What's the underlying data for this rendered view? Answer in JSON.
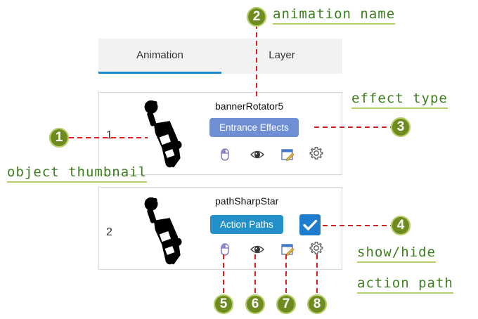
{
  "tabs": [
    {
      "label": "Animation",
      "active": true
    },
    {
      "label": "Layer",
      "active": false
    }
  ],
  "rows": [
    {
      "number": "1",
      "name": "bannerRotator5",
      "effect": "Entrance Effects"
    },
    {
      "number": "2",
      "name": "pathSharpStar",
      "effect": "Action Paths",
      "show_action_path": true
    }
  ],
  "callouts": {
    "c1": {
      "badge": "1",
      "text": "object thumbnail"
    },
    "c2": {
      "badge": "2",
      "text": "animation name"
    },
    "c3": {
      "badge": "3",
      "text": "effect type"
    },
    "c4": {
      "badge": "4",
      "text_line1": "show/hide",
      "text_line2": "action path"
    },
    "c5": {
      "badge": "5"
    },
    "c6": {
      "badge": "6"
    },
    "c7": {
      "badge": "7"
    },
    "c8": {
      "badge": "8"
    }
  },
  "colors": {
    "tab_accent": "#1c8ad3",
    "entrance_button": "#6e8fd4",
    "action_button": "#2391c7",
    "checkbox": "#1e7ccf",
    "callout_line": "#e01e1e",
    "callout_text": "#3b7e1c",
    "badge": "#6e8b1f"
  },
  "icons": [
    "mouse-trigger-icon",
    "eye-preview-icon",
    "edit-window-icon",
    "gear-settings-icon",
    "checkmark-icon",
    "car-thumbnail-icon"
  ]
}
